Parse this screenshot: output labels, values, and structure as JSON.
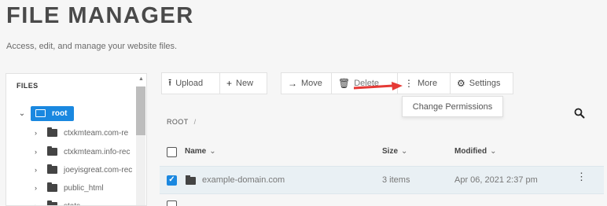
{
  "header": {
    "title": "FILE MANAGER",
    "subtitle": "Access, edit, and manage your website files."
  },
  "sidebar": {
    "heading": "FILES",
    "root_label": "root",
    "items": [
      {
        "label": "ctxkmteam.com-re"
      },
      {
        "label": "ctxkmteam.info-rec"
      },
      {
        "label": "joeyisgreat.com-rec"
      },
      {
        "label": "public_html"
      },
      {
        "label": "stats"
      }
    ]
  },
  "toolbar": {
    "upload_label": "Upload",
    "new_label": "New",
    "move_label": "Move",
    "delete_label": "Delete",
    "more_label": "More",
    "settings_label": "Settings"
  },
  "more_menu": {
    "change_permissions_label": "Change Permissions"
  },
  "breadcrumb": {
    "root": "ROOT",
    "separator": "/"
  },
  "table": {
    "columns": {
      "name": "Name",
      "size": "Size",
      "modified": "Modified"
    },
    "rows": [
      {
        "name": "example-domain.com",
        "size": "3 items",
        "modified": "Apr 06, 2021 2:37 pm",
        "selected": true
      }
    ]
  },
  "colors": {
    "accent": "#1a88e0",
    "annotation_arrow": "#e53935",
    "selected_row": "#e9f0f4"
  },
  "icons": [
    "upload-icon",
    "plus-icon",
    "arrow-right-icon",
    "trash-icon",
    "kebab-icon",
    "gear-icon",
    "search-icon",
    "folder-icon",
    "chevron-down-icon",
    "chevron-right-icon"
  ]
}
